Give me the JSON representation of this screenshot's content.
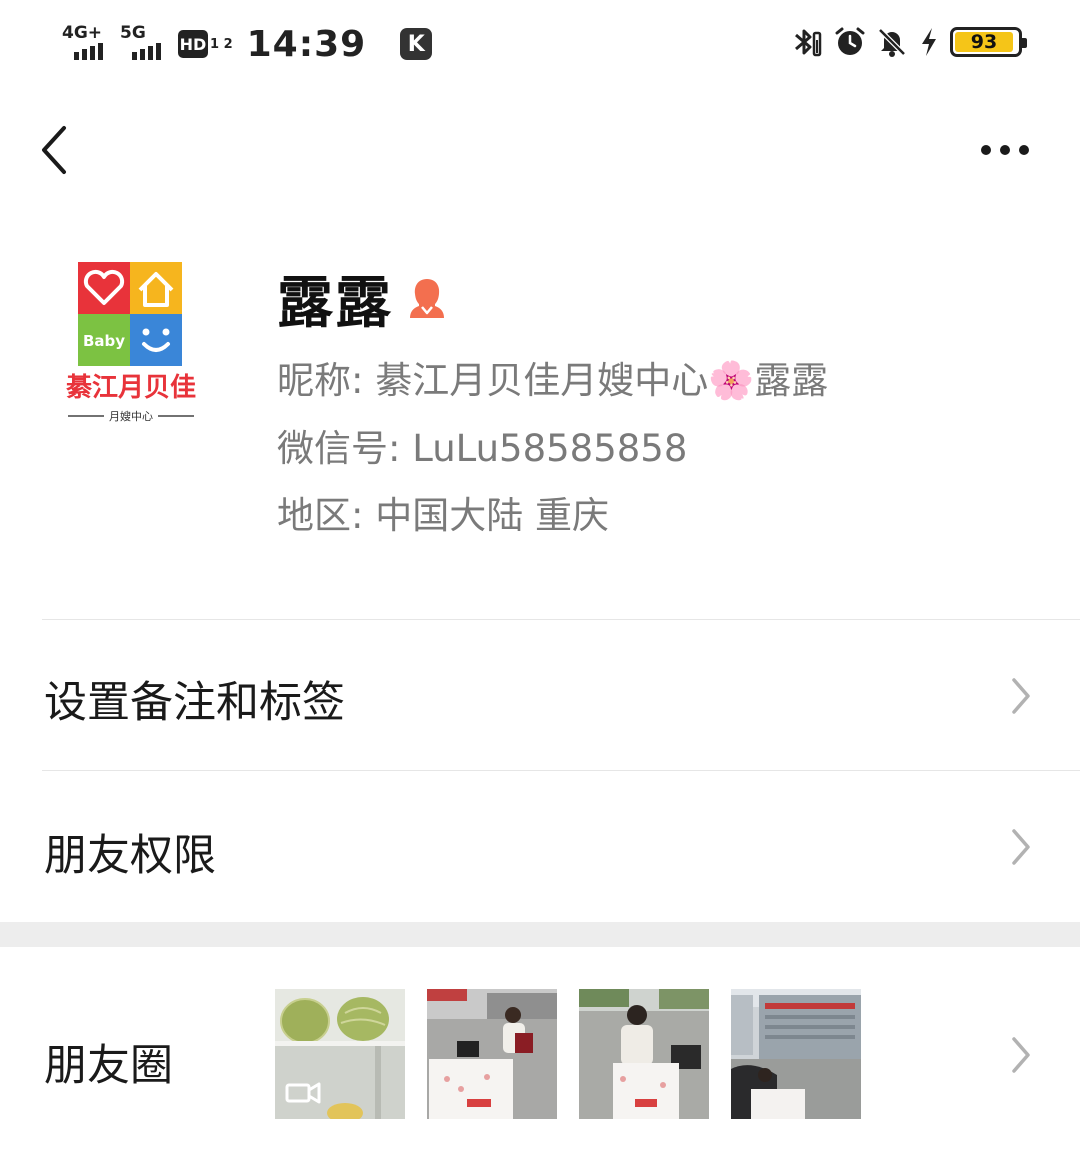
{
  "status_bar": {
    "network1": "4G+",
    "network2": "5G",
    "hd": "HD",
    "hd_sub": "1 2",
    "time": "14:39",
    "app_badge": "K",
    "battery": "93"
  },
  "profile": {
    "name": "露露",
    "nickname_label": "昵称: ",
    "nickname_value": "綦江月贝佳月嫂中心🌸露露",
    "wechat_label": "微信号: ",
    "wechat_value": "LuLu58585858",
    "region_label": "地区: ",
    "region_value": "中国大陆  重庆",
    "avatar_logo_text": "綦江月贝佳",
    "avatar_sub_text": "月嫂中心",
    "avatar_baby_text": "Baby"
  },
  "menu": {
    "remark_label": "设置备注和标签",
    "permission_label": "朋友权限",
    "moments_label": "朋友圈"
  },
  "colors": {
    "accent_gender": "#f36f4f",
    "divider": "#e6e6e6",
    "section_gap": "#ededed",
    "secondary_text": "#7a7a7a",
    "battery_fill": "#f5c518"
  }
}
